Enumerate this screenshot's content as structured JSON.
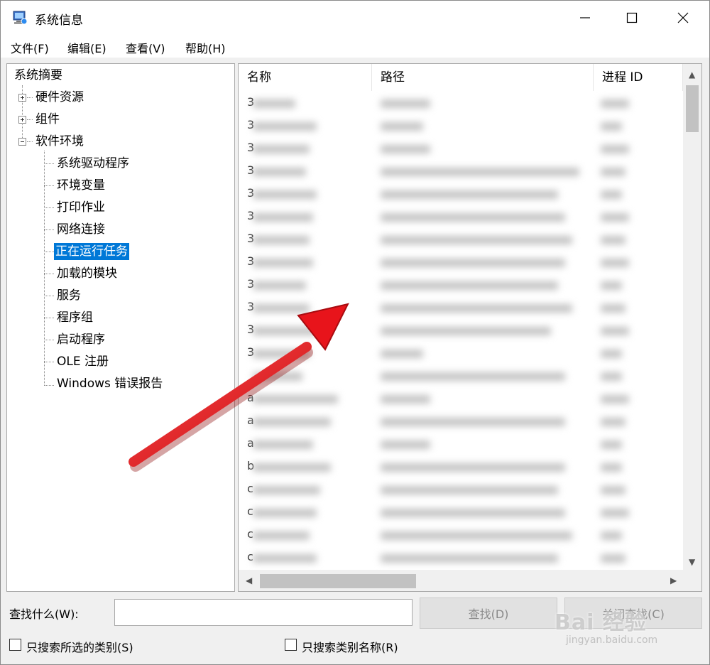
{
  "window": {
    "title": "系统信息"
  },
  "menu": [
    {
      "label": "文件(F)"
    },
    {
      "label": "编辑(E)"
    },
    {
      "label": "查看(V)"
    },
    {
      "label": "帮助(H)"
    }
  ],
  "tree": {
    "root": "系统摘要",
    "nodes": [
      {
        "label": "硬件资源",
        "expander": "+"
      },
      {
        "label": "组件",
        "expander": "+"
      },
      {
        "label": "软件环境",
        "expander": "-"
      }
    ],
    "children": [
      {
        "label": "系统驱动程序"
      },
      {
        "label": "环境变量"
      },
      {
        "label": "打印作业"
      },
      {
        "label": "网络连接"
      },
      {
        "label": "正在运行任务",
        "selected": true
      },
      {
        "label": "加载的模块"
      },
      {
        "label": "服务"
      },
      {
        "label": "程序组"
      },
      {
        "label": "启动程序"
      },
      {
        "label": "OLE 注册"
      },
      {
        "label": "Windows 错误报告"
      }
    ]
  },
  "list": {
    "columns": [
      {
        "label": "名称"
      },
      {
        "label": "路径"
      },
      {
        "label": "进程 ID"
      }
    ],
    "first_letters": [
      "3",
      "3",
      "3",
      "3",
      "3",
      "3",
      "3",
      "3",
      "3",
      "3",
      "3",
      "3",
      "",
      "a",
      "a",
      "a",
      "b",
      "c",
      "c",
      "c",
      "c"
    ]
  },
  "find": {
    "label": "查找什么(W):",
    "value": "",
    "find_button": "查找(D)",
    "close_button": "关闭查找(C)"
  },
  "options": [
    {
      "label": "只搜索所选的类别(S)",
      "checked": false
    },
    {
      "label": "只搜索类别名称(R)",
      "checked": false
    }
  ],
  "watermark": {
    "brand": "Bai 经验",
    "url": "jingyan.baidu.com"
  },
  "colors": {
    "selection": "#0078d7",
    "annotation_arrow": "#e8141b"
  }
}
